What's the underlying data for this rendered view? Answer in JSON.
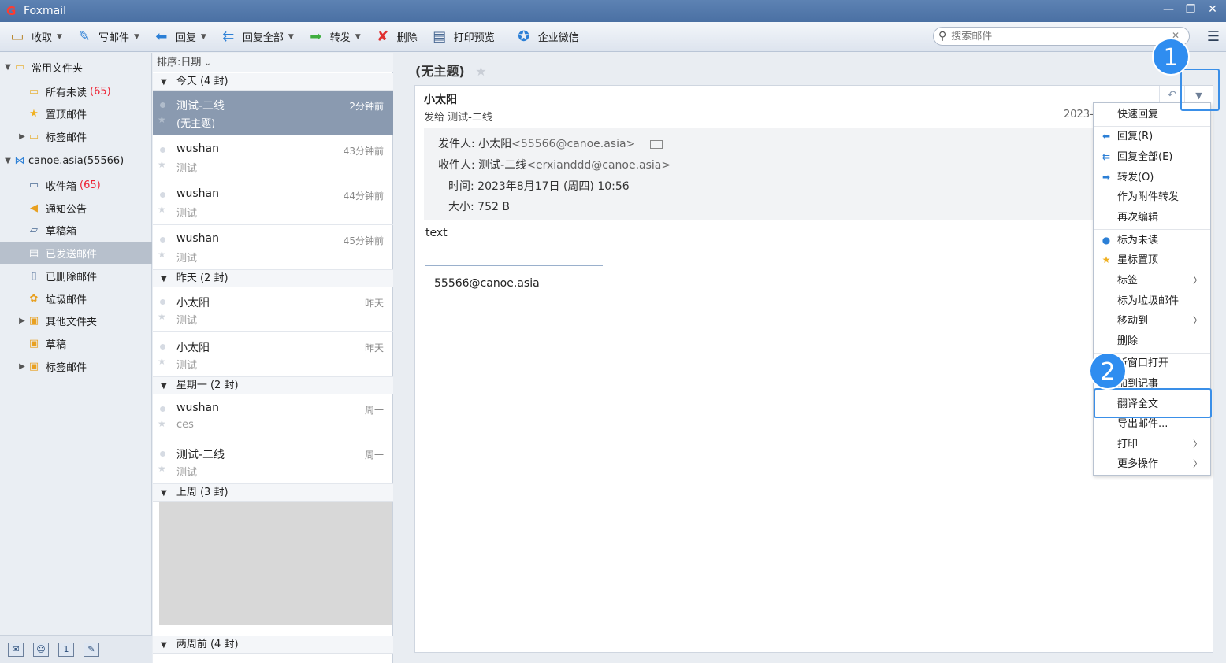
{
  "window": {
    "title": "Foxmail"
  },
  "toolbar": {
    "receive": "收取",
    "compose": "写邮件",
    "reply": "回复",
    "reply_all": "回复全部",
    "forward": "转发",
    "delete": "删除",
    "print_preview": "打印预览",
    "wecom": "企业微信"
  },
  "search": {
    "placeholder": "搜索邮件"
  },
  "sidebar": {
    "items": [
      {
        "label": "常用文件夹",
        "count": ""
      },
      {
        "label": "所有未读",
        "count": "(65)"
      },
      {
        "label": "置顶邮件",
        "count": ""
      },
      {
        "label": "标签邮件",
        "count": ""
      },
      {
        "label": "canoe.asia(55566)",
        "count": ""
      },
      {
        "label": "收件箱",
        "count": "(65)"
      },
      {
        "label": "通知公告",
        "count": ""
      },
      {
        "label": "草稿箱",
        "count": ""
      },
      {
        "label": "已发送邮件",
        "count": ""
      },
      {
        "label": "已删除邮件",
        "count": ""
      },
      {
        "label": "垃圾邮件",
        "count": ""
      },
      {
        "label": "其他文件夹",
        "count": ""
      },
      {
        "label": "草稿",
        "count": ""
      },
      {
        "label": "标签邮件",
        "count": ""
      }
    ]
  },
  "maillist": {
    "sort": "排序:日期",
    "groups": {
      "today": "今天 (4 封)",
      "yesterday": "昨天 (2 封)",
      "monday": "星期一 (2 封)",
      "lastweek": "上周 (3 封)",
      "twoweeks": "两周前 (4 封)"
    },
    "mails": [
      {
        "sender": "测试-二线",
        "subject": "(无主题)",
        "time": "2分钟前"
      },
      {
        "sender": "wushan",
        "subject": "测试",
        "time": "43分钟前"
      },
      {
        "sender": "wushan",
        "subject": "测试",
        "time": "44分钟前"
      },
      {
        "sender": "wushan",
        "subject": "测试",
        "time": "45分钟前"
      },
      {
        "sender": "小太阳",
        "subject": "测试",
        "time": "昨天"
      },
      {
        "sender": "小太阳",
        "subject": "测试",
        "time": "昨天"
      },
      {
        "sender": "wushan",
        "subject": "ces",
        "time": "周一"
      },
      {
        "sender": "测试-二线",
        "subject": "测试",
        "time": "周一"
      }
    ]
  },
  "reader": {
    "subject": "(无主题)",
    "from_name": "小太阳",
    "to_line": "发给 测试-二线",
    "date_short": "2023-",
    "header": {
      "from_label": "发件人:",
      "from_value": "小太阳",
      "from_email": "<55566@canoe.asia>",
      "to_label": "收件人:",
      "to_value": "测试-二线",
      "to_email": "<erxianddd@canoe.asia>",
      "time_label": "时间:",
      "time_value": "2023年8月17日 (周四) 10:56",
      "size_label": "大小:",
      "size_value": "752 B"
    },
    "body": "text",
    "signature": "55566@canoe.asia"
  },
  "menu": {
    "items": [
      "快速回复",
      "回复(R)",
      "回复全部(E)",
      "转发(O)",
      "作为附件转发",
      "再次编辑",
      "标为未读",
      "星标置顶",
      "标签",
      "标为垃圾邮件",
      "移动到",
      "删除",
      "新窗口打开",
      "加到记事",
      "翻译全文",
      "导出邮件...",
      "打印",
      "更多操作"
    ]
  },
  "annotations": {
    "badge1": "1",
    "badge2": "2"
  },
  "colors": {
    "accent": "#2f8df0",
    "selected_row": "#8a9ab0",
    "unread_count": "#ee2233"
  }
}
